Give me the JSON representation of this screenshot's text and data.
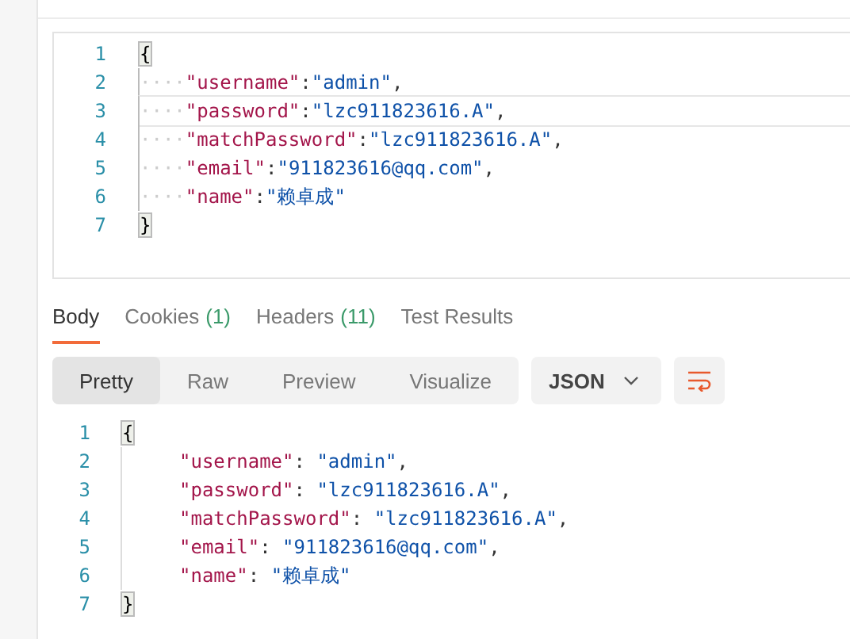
{
  "request_editor": {
    "lines": [
      {
        "number": "1",
        "current": false,
        "tokens": [
          {
            "kind": "brace",
            "text": "{"
          }
        ]
      },
      {
        "number": "2",
        "current": false,
        "tokens": [
          {
            "kind": "ws",
            "text": "····"
          },
          {
            "kind": "key",
            "text": "\"username\""
          },
          {
            "kind": "punct",
            "text": ":"
          },
          {
            "kind": "string",
            "text": "\"admin\""
          },
          {
            "kind": "punct",
            "text": ","
          }
        ]
      },
      {
        "number": "3",
        "current": true,
        "tokens": [
          {
            "kind": "ws",
            "text": "····"
          },
          {
            "kind": "key",
            "text": "\"password\""
          },
          {
            "kind": "punct",
            "text": ":"
          },
          {
            "kind": "string",
            "text": "\"lzc911823616.A\""
          },
          {
            "kind": "punct",
            "text": ","
          }
        ]
      },
      {
        "number": "4",
        "current": false,
        "tokens": [
          {
            "kind": "ws",
            "text": "····"
          },
          {
            "kind": "key",
            "text": "\"matchPassword\""
          },
          {
            "kind": "punct",
            "text": ":"
          },
          {
            "kind": "string",
            "text": "\"lzc911823616.A\""
          },
          {
            "kind": "punct",
            "text": ","
          }
        ]
      },
      {
        "number": "5",
        "current": false,
        "tokens": [
          {
            "kind": "ws",
            "text": "····"
          },
          {
            "kind": "key",
            "text": "\"email\""
          },
          {
            "kind": "punct",
            "text": ":"
          },
          {
            "kind": "string",
            "text": "\"911823616@qq.com\""
          },
          {
            "kind": "punct",
            "text": ","
          }
        ]
      },
      {
        "number": "6",
        "current": false,
        "tokens": [
          {
            "kind": "ws",
            "text": "····"
          },
          {
            "kind": "key",
            "text": "\"name\""
          },
          {
            "kind": "punct",
            "text": ":"
          },
          {
            "kind": "string",
            "text": "\"赖卓成\""
          }
        ]
      },
      {
        "number": "7",
        "current": false,
        "tokens": [
          {
            "kind": "brace",
            "text": "}"
          }
        ]
      }
    ]
  },
  "response_tabs": [
    {
      "label": "Body",
      "selected": true
    },
    {
      "label": "Cookies",
      "count": "(1)",
      "selected": false
    },
    {
      "label": "Headers",
      "count": "(11)",
      "selected": false
    },
    {
      "label": "Test Results",
      "selected": false
    }
  ],
  "view_modes": [
    {
      "label": "Pretty",
      "selected": true
    },
    {
      "label": "Raw",
      "selected": false
    },
    {
      "label": "Preview",
      "selected": false
    },
    {
      "label": "Visualize",
      "selected": false
    }
  ],
  "format_dropdown": {
    "value": "JSON"
  },
  "response_body": {
    "lines": [
      {
        "number": "1",
        "indented": false,
        "tokens": [
          {
            "kind": "brace",
            "text": "{"
          }
        ]
      },
      {
        "number": "2",
        "indented": true,
        "tokens": [
          {
            "kind": "key",
            "text": "\"username\""
          },
          {
            "kind": "punct",
            "text": ": "
          },
          {
            "kind": "string",
            "text": "\"admin\""
          },
          {
            "kind": "punct",
            "text": ","
          }
        ]
      },
      {
        "number": "3",
        "indented": true,
        "tokens": [
          {
            "kind": "key",
            "text": "\"password\""
          },
          {
            "kind": "punct",
            "text": ": "
          },
          {
            "kind": "string",
            "text": "\"lzc911823616.A\""
          },
          {
            "kind": "punct",
            "text": ","
          }
        ]
      },
      {
        "number": "4",
        "indented": true,
        "tokens": [
          {
            "kind": "key",
            "text": "\"matchPassword\""
          },
          {
            "kind": "punct",
            "text": ": "
          },
          {
            "kind": "string",
            "text": "\"lzc911823616.A\""
          },
          {
            "kind": "punct",
            "text": ","
          }
        ]
      },
      {
        "number": "5",
        "indented": true,
        "tokens": [
          {
            "kind": "key",
            "text": "\"email\""
          },
          {
            "kind": "punct",
            "text": ": "
          },
          {
            "kind": "string",
            "text": "\"911823616@qq.com\""
          },
          {
            "kind": "punct",
            "text": ","
          }
        ]
      },
      {
        "number": "6",
        "indented": true,
        "tokens": [
          {
            "kind": "key",
            "text": "\"name\""
          },
          {
            "kind": "punct",
            "text": ": "
          },
          {
            "kind": "string",
            "text": "\"赖卓成\""
          }
        ]
      },
      {
        "number": "7",
        "indented": false,
        "tokens": [
          {
            "kind": "brace",
            "text": "}"
          }
        ]
      }
    ]
  }
}
